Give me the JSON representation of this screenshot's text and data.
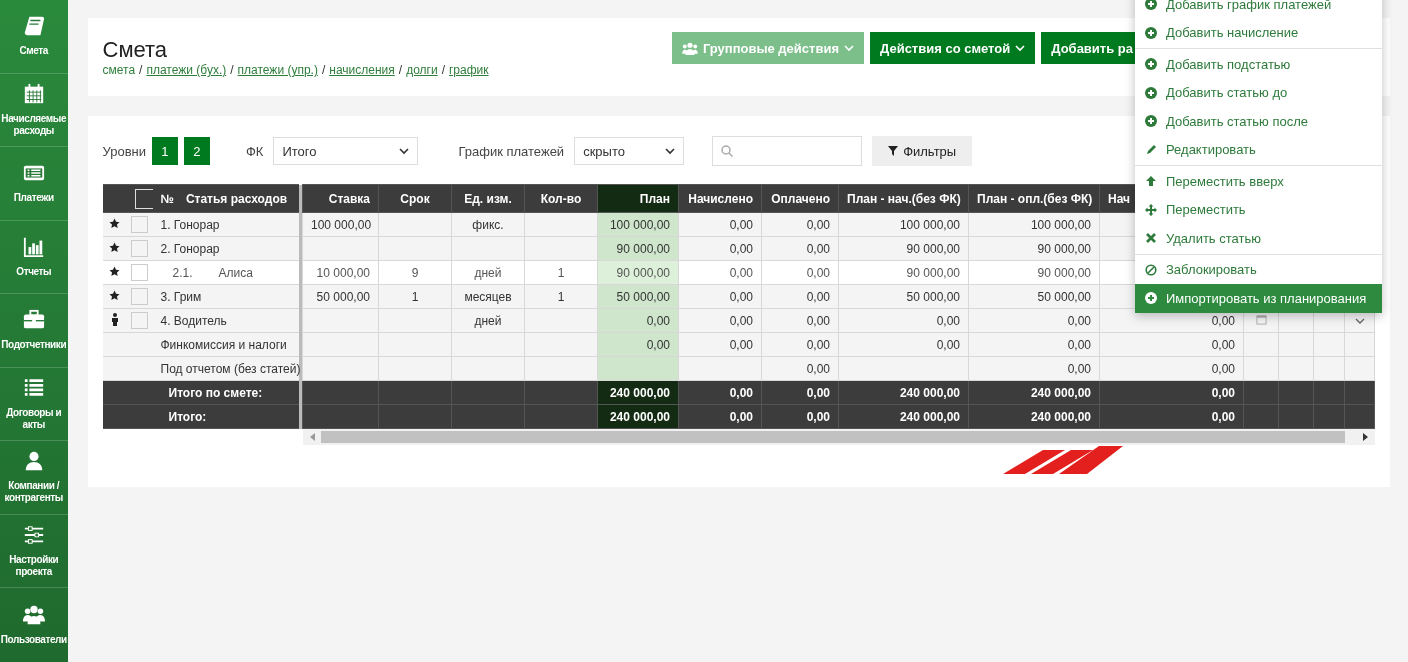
{
  "sidebar": {
    "items": [
      {
        "label": "Смета",
        "kind": "book"
      },
      {
        "label": "Начисляемые расходы",
        "kind": "calendar"
      },
      {
        "label": "Платежи",
        "kind": "list-card"
      },
      {
        "label": "Отчеты",
        "kind": "chart"
      },
      {
        "label": "Подотчетники",
        "kind": "briefcase"
      },
      {
        "label": "Договоры и акты",
        "kind": "list"
      },
      {
        "label": "Компании / контрагенты",
        "kind": "user"
      },
      {
        "label": "Настройки проекта",
        "kind": "sliders"
      },
      {
        "label": "Пользователи",
        "kind": "users"
      }
    ]
  },
  "header": {
    "title": "Смета",
    "separator": "/",
    "breadcrumbs": [
      {
        "label": "смета",
        "link": false
      },
      {
        "label": "платежи (бух.)",
        "link": true
      },
      {
        "label": "платежи (упр.)",
        "link": true
      },
      {
        "label": "начисления",
        "link": true
      },
      {
        "label": "долги",
        "link": true
      },
      {
        "label": "график",
        "link": true
      }
    ],
    "buttons": [
      {
        "label": "Групповые действия",
        "disabled": true,
        "caret": true
      },
      {
        "label": "Действия со сметой",
        "disabled": false,
        "caret": true
      },
      {
        "label": "Добавить ра",
        "disabled": false,
        "caret": false
      }
    ]
  },
  "filters": {
    "levels_label": "Уровни",
    "levels": [
      "1",
      "2"
    ],
    "fk_label": "ФК",
    "fk_value": "Итого",
    "schedule_label": "График платежей",
    "schedule_value": "скрыто",
    "filter_button": "Фильтры"
  },
  "table": {
    "select_all_checked": false,
    "columns": [
      "№",
      "Статья расходов",
      "Ставка",
      "Срок",
      "Ед. изм.",
      "Кол-во",
      "План",
      "Начислено",
      "Оплачено",
      "План - нач.(без ФК)",
      "План - опл.(без ФК)",
      "Нач"
    ],
    "rows": [
      {
        "kind": "item",
        "label": "1. Гонорар",
        "checked": false,
        "rate": "100 000,00",
        "unit": "фикс.",
        "plan": "100 000,00",
        "accrued": "0,00",
        "paid": "0,00",
        "plan_minus_accrued": "100 000,00",
        "plan_minus_paid": "100 000,00"
      },
      {
        "kind": "item",
        "label": "2. Гонорар",
        "checked": false,
        "plan": "90 000,00",
        "accrued": "0,00",
        "paid": "0,00",
        "plan_minus_accrued": "90 000,00",
        "plan_minus_paid": "90 000,00"
      },
      {
        "kind": "subitem",
        "number": "2.1.",
        "label": "Алиса",
        "checked": false,
        "rate": "10 000,00",
        "term": "9",
        "unit": "дней",
        "qty": "1",
        "plan": "90 000,00",
        "accrued": "0,00",
        "paid": "0,00",
        "plan_minus_accrued": "90 000,00",
        "plan_minus_paid": "90 000,00"
      },
      {
        "kind": "item",
        "label": "3. Грим",
        "checked": false,
        "rate": "50 000,00",
        "term": "1",
        "unit": "месяцев",
        "qty": "1",
        "plan": "50 000,00",
        "accrued": "0,00",
        "paid": "0,00",
        "plan_minus_accrued": "50 000,00",
        "plan_minus_paid": "50 000,00"
      },
      {
        "kind": "person",
        "label": "4. Водитель",
        "checked": false,
        "unit": "дней",
        "plan": "0,00",
        "accrued": "0,00",
        "paid": "0,00",
        "plan_minus_accrued": "0,00",
        "plan_minus_paid": "0,00",
        "column_12": "0,00"
      },
      {
        "kind": "summary",
        "label": "Финкомиссия и налоги",
        "plan": "0,00",
        "accrued": "0,00",
        "paid": "0,00",
        "plan_minus_accrued": "0,00",
        "plan_minus_paid": "0,00",
        "column_12": "0,00"
      },
      {
        "kind": "summary",
        "label": "Под отчетом (без статей)",
        "paid": "0,00",
        "plan_minus_paid": "0,00",
        "column_12": "0,00"
      },
      {
        "kind": "total",
        "label": "Итого по смете:",
        "plan": "240 000,00",
        "accrued": "0,00",
        "paid": "0,00",
        "plan_minus_accrued": "240 000,00",
        "plan_minus_paid": "240 000,00",
        "column_12": "0,00"
      },
      {
        "kind": "total",
        "label": "Итого:",
        "plan": "240 000,00",
        "accrued": "0,00",
        "paid": "0,00",
        "plan_minus_accrued": "240 000,00",
        "plan_minus_paid": "240 000,00",
        "column_12": "0,00"
      }
    ]
  },
  "context_menu": {
    "groups": [
      [
        {
          "label": "Добавить график платежей",
          "kind": "add",
          "selected": false
        },
        {
          "label": "Добавить начисление",
          "kind": "add",
          "selected": false
        }
      ],
      [
        {
          "label": "Добавить подстатью",
          "kind": "add",
          "selected": false
        },
        {
          "label": "Добавить статью до",
          "kind": "add",
          "selected": false
        },
        {
          "label": "Добавить статью после",
          "kind": "add",
          "selected": false
        },
        {
          "label": "Редактировать",
          "kind": "edit",
          "selected": false
        }
      ],
      [
        {
          "label": "Переместить вверх",
          "kind": "move-up",
          "selected": false
        },
        {
          "label": "Переместить",
          "kind": "move",
          "selected": false
        },
        {
          "label": "Удалить статью",
          "kind": "delete",
          "selected": false
        }
      ],
      [
        {
          "label": "Заблокировать",
          "kind": "block",
          "selected": false
        },
        {
          "label": "Импортировать из планирования",
          "kind": "add",
          "selected": true
        }
      ]
    ]
  }
}
